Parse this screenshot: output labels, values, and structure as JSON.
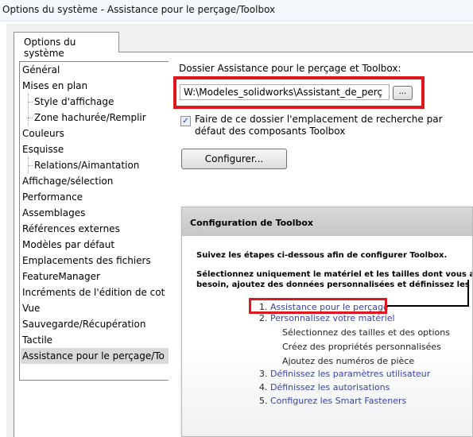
{
  "window": {
    "title": "Options du système - Assistance pour le perçage/Toolbox"
  },
  "tab": {
    "label": "Options du système"
  },
  "tree": {
    "items": [
      {
        "label": "Général"
      },
      {
        "label": "Mises en plan"
      },
      {
        "label": "Style d'affichage"
      },
      {
        "label": "Zone hachurée/Remplir"
      },
      {
        "label": "Couleurs"
      },
      {
        "label": "Esquisse"
      },
      {
        "label": "Relations/Aimantation"
      },
      {
        "label": "Affichage/sélection"
      },
      {
        "label": "Performance"
      },
      {
        "label": "Assemblages"
      },
      {
        "label": "Références externes"
      },
      {
        "label": "Modèles par défaut"
      },
      {
        "label": "Emplacements des fichiers"
      },
      {
        "label": "FeatureManager"
      },
      {
        "label": "Incréments de l'édition de cot"
      },
      {
        "label": "Vue"
      },
      {
        "label": "Sauvegarde/Récupération"
      },
      {
        "label": "Tactile"
      },
      {
        "label": "Assistance pour le perçage/To"
      }
    ],
    "selected": "Assistance pour le perçage/To"
  },
  "settings": {
    "folder_label": "Dossier Assistance pour le perçage et Toolbox:",
    "folder_path": "W:\\Modeles_solidworks\\Assistant_de_perç",
    "browse_label": "...",
    "checkbox_checked": true,
    "checkbox_mark": "✓",
    "checkbox_label": "Faire de ce dossier l'emplacement de recherche par défaut des composants Toolbox",
    "configure_label": "Configurer..."
  },
  "toolbox": {
    "header": "Configuration de Toolbox",
    "intro": "Suivez les étapes ci-dessous afin de configurer Toolbox.",
    "desc_line1": "Sélectionnez uniquement le matériel et les tailles dont vous ave",
    "desc_line2": "besoin, ajoutez des données personnalisées et définissez les op",
    "steps": [
      {
        "num": "1.",
        "label": "Assistance pour le perçage"
      },
      {
        "num": "2.",
        "label": "Personnalisez votre matériel"
      },
      {
        "num": "3.",
        "label": "Définissez les paramètres utilisateur"
      },
      {
        "num": "4.",
        "label": "Définissez les autorisations"
      },
      {
        "num": "5.",
        "label": "Configurez les Smart Fasteners"
      }
    ],
    "substeps": [
      "Sélectionnez des tailles et des options",
      "Créez des propriétés personnalisées",
      "Ajoutez des numéros de pièce"
    ]
  },
  "colors": {
    "highlight_red": "#e0161e",
    "link_blue": "#3a3fa5",
    "selection_gray": "#d9d9d9"
  }
}
